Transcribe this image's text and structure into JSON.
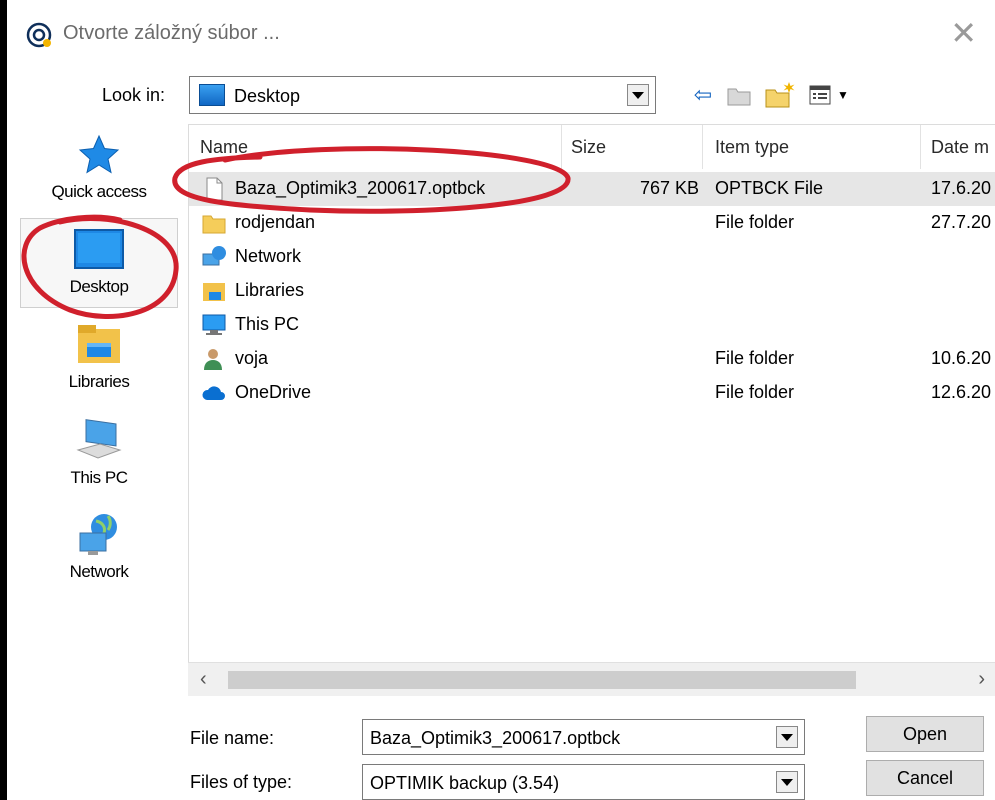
{
  "window": {
    "title": "Otvorte záložný súbor ...",
    "close_glyph": "✕"
  },
  "look_in": {
    "label": "Look in:",
    "value": "Desktop"
  },
  "places": [
    {
      "label": "Quick access",
      "icon": "star-icon"
    },
    {
      "label": "Desktop",
      "icon": "desktop-icon",
      "selected": true
    },
    {
      "label": "Libraries",
      "icon": "libraries-icon"
    },
    {
      "label": "This PC",
      "icon": "computer-icon"
    },
    {
      "label": "Network",
      "icon": "network-icon"
    }
  ],
  "columns": {
    "name": "Name",
    "size": "Size",
    "type": "Item type",
    "date": "Date m"
  },
  "files": [
    {
      "name": "Baza_Optimik3_200617.optbck",
      "size": "767 KB",
      "type": "OPTBCK File",
      "date": "17.6.20",
      "icon": "document-icon",
      "selected": true
    },
    {
      "name": "rodjendan",
      "size": "",
      "type": "File folder",
      "date": "27.7.20",
      "icon": "folder-icon"
    },
    {
      "name": "Network",
      "size": "",
      "type": "",
      "date": "",
      "icon": "network-icon"
    },
    {
      "name": "Libraries",
      "size": "",
      "type": "",
      "date": "",
      "icon": "libraries-icon"
    },
    {
      "name": "This PC",
      "size": "",
      "type": "",
      "date": "",
      "icon": "computer-icon"
    },
    {
      "name": "voja",
      "size": "",
      "type": "File folder",
      "date": "10.6.20",
      "icon": "user-icon"
    },
    {
      "name": "OneDrive",
      "size": "",
      "type": "File folder",
      "date": "12.6.20",
      "icon": "cloud-icon"
    }
  ],
  "file_name": {
    "label": "File name:",
    "value": "Baza_Optimik3_200617.optbck"
  },
  "file_type": {
    "label": "Files of type:",
    "value": "OPTIMIK backup (3.54)"
  },
  "buttons": {
    "open": "Open",
    "cancel": "Cancel"
  },
  "scrollbar": {
    "left": "‹",
    "right": "›"
  },
  "colors": {
    "annotation": "#d0202c",
    "selection": "#e6e6e6",
    "accent": "#1565c0"
  }
}
